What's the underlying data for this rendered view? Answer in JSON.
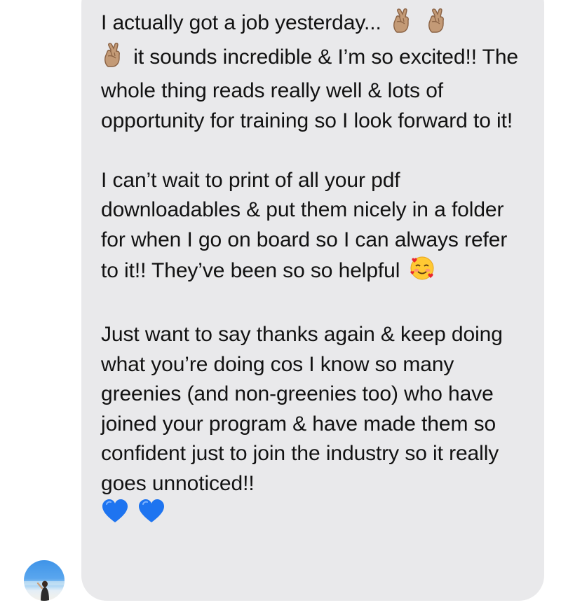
{
  "message": {
    "paragraph_1": {
      "line_1": "I actually got a job yesterday...",
      "line_2": "it sounds incredible & I’m so",
      "line_3": "excited!! The whole thing reads really well & lots of opportunity for training so I look forward to it!"
    },
    "paragraph_2": {
      "text": "I can’t wait to print of all your pdf downloadables & put them nicely in a folder for when I go on board so I can always refer to it!! They’ve been so so helpful"
    },
    "paragraph_3": {
      "text": "Just want to say thanks again & keep doing what you’re doing cos I know so many greenies (and non-greenies too) who have joined your program & have made them so confident just to join the industry so it really goes unnoticed!!"
    },
    "emojis": {
      "crossed_fingers": "crossed-fingers-emoji",
      "smiling_hearts": "smiling-face-with-hearts-emoji",
      "blue_heart": "blue-heart-emoji"
    }
  },
  "colors": {
    "bubble_background": "#e9e9eb",
    "text": "#121212",
    "blue_heart": "#1e74f0",
    "skin_tone": "#c39a76"
  },
  "avatar": {
    "icon": "sender-avatar-photo"
  }
}
